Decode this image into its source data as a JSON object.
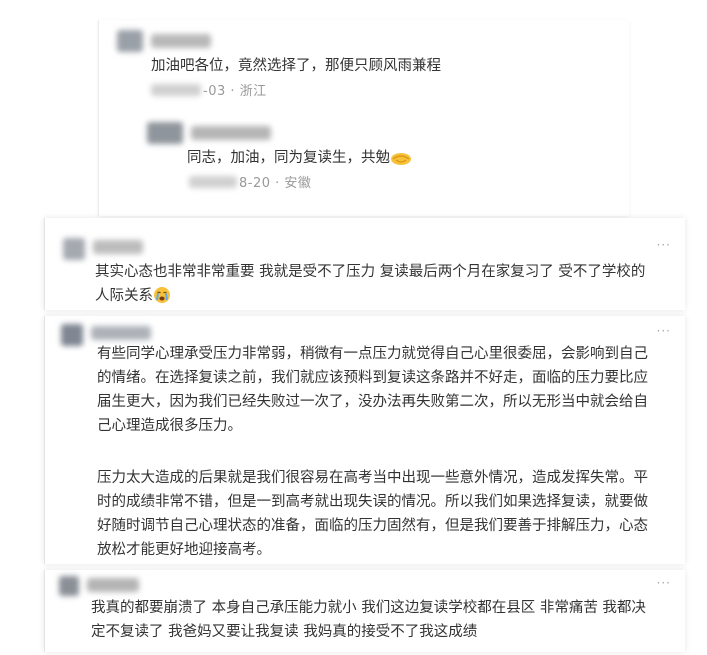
{
  "comments": {
    "c1": {
      "text": "加油吧各位，竟然选择了，那便只顾风雨兼程",
      "date_suffix": "-03",
      "region": "浙江",
      "reply": {
        "text": "同志，加油，同为复读生，共勉",
        "date_suffix": "8-20",
        "region": "安徽"
      }
    },
    "c2": {
      "text_line1": "其实心态也非常非常重要 我就是受不了压力 复读最后两个月在家复习了 受不了学校的",
      "text_line2": "人际关系",
      "more": "···"
    },
    "c3": {
      "paragraph1": [
        "有些同学心理承受压力非常弱，稍微有一点压力就觉得自己心里很委屈，会影响到自己",
        "的情绪。在选择复读之前，我们就应该预料到复读这条路并不好走，面临的压力要比应",
        "届生更大，因为我们已经失败过一次了，没办法再失败第二次，所以无形当中就会给自",
        "己心理造成很多压力。"
      ],
      "paragraph2": [
        "压力太大造成的后果就是我们很容易在高考当中出现一些意外情况，造成发挥失常。平",
        "时的成绩非常不错，但是一到高考就出现失误的情况。所以我们如果选择复读，就要做",
        "好随时调节自己心理状态的准备，面临的压力固然有，但是我们要善于排解压力，心态",
        "放松才能更好地迎接高考。"
      ],
      "more": "···"
    },
    "c4": {
      "text_line1": "我真的都要崩溃了 本身自己承压能力就小 我们这边复读学校都在县区 非常痛苦 我都决",
      "text_line2": "定不复读了 我爸妈又要让我复读 我妈真的接受不了我这成绩",
      "more": "···"
    }
  },
  "colors": {
    "text": "#333333",
    "meta": "#999999",
    "card_border": "#e4e4e4"
  },
  "icons": [
    "crying-face-emoji",
    "clasped-hands-emoji",
    "more-icon"
  ]
}
